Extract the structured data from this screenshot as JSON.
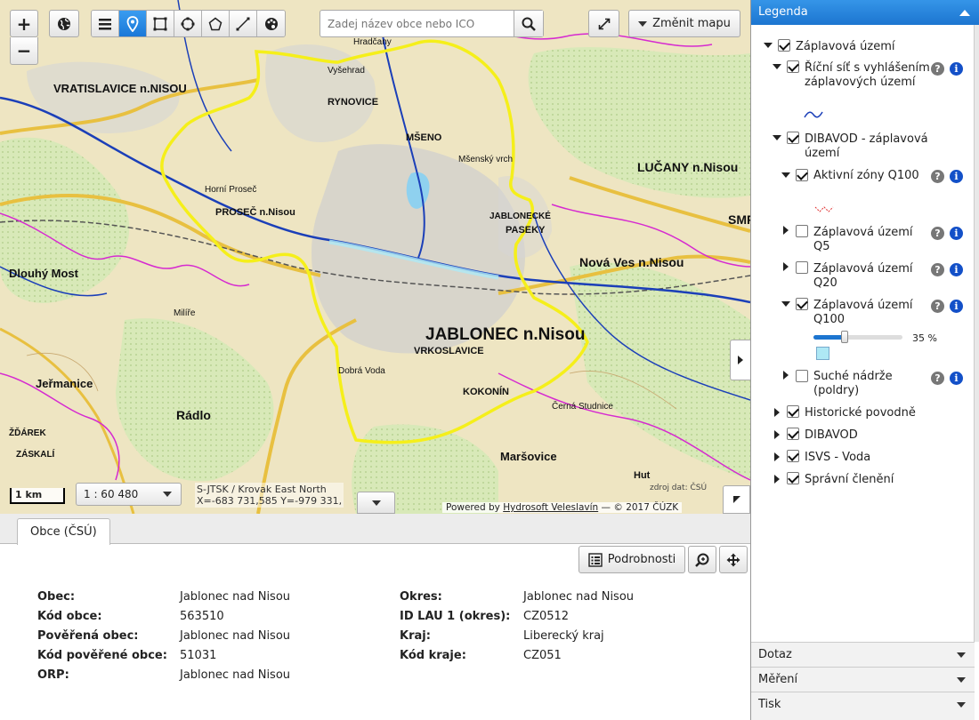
{
  "toolbar": {
    "zoom_in": "+",
    "zoom_out": "−",
    "icons": [
      "globe-icon",
      "layers-list-icon",
      "pin-icon",
      "rectangle-icon",
      "circle-icon",
      "polygon-icon",
      "line-icon",
      "palette-icon",
      "search-icon",
      "fullscreen-icon"
    ],
    "active_tool": "pin",
    "search_placeholder": "Zadej název obce nebo ICO",
    "change_map_label": "Změnit mapu"
  },
  "map": {
    "labels": [
      "VRATISLAVICE n.NISOU",
      "RYNOVICE",
      "MŠENO",
      "JABLONEC n.Nisou",
      "VRKOSLAVICE",
      "PASEKY",
      "JABLONECKÉ",
      "Nová Ves n.Nisou",
      "LUČANY n.Nisou",
      "PROSEČ n.Nisou",
      "Dlouhý Most",
      "Jeřmanice",
      "Rádlo",
      "Maršovice",
      "KOKONÍN",
      "Horní Proseč",
      "Mšenský vrch",
      "Hradčany",
      "Vyšehrad",
      "Milíře",
      "Dobrá Voda",
      "ŽĎÁREK",
      "ZÁSKALÍ",
      "Hut",
      "Černá Studnice",
      "SMR"
    ],
    "scale_bar": "1 km",
    "scale": "1 : 60 480",
    "crs": "S-JTSK / Krovak East North",
    "coords": "X=-683 731,585 Y=-979 331,",
    "powered_prefix": "Powered by",
    "powered_link": "Hydrosoft Veleslavín",
    "copyright": "— © 2017 ČÚZK",
    "source": "zdroj dat: ČSÚ"
  },
  "bottom": {
    "tab": "Obce (ČSÚ)",
    "details_button": "Podrobnosti",
    "left_fields": [
      {
        "key": "Obec:",
        "value": "Jablonec nad Nisou"
      },
      {
        "key": "Kód obce:",
        "value": "563510"
      },
      {
        "key": "Pověřená obec:",
        "value": "Jablonec nad Nisou"
      },
      {
        "key": "Kód pověřené obce:",
        "value": "51031"
      },
      {
        "key": "ORP:",
        "value": "Jablonec nad Nisou"
      }
    ],
    "right_fields": [
      {
        "key": "Okres:",
        "value": "Jablonec nad Nisou"
      },
      {
        "key": "ID LAU 1 (okres):",
        "value": "CZ0512"
      },
      {
        "key": "Kraj:",
        "value": "Liberecký kraj"
      },
      {
        "key": "Kód kraje:",
        "value": "CZ051"
      }
    ]
  },
  "legend": {
    "title": "Legenda",
    "items": [
      {
        "label": "Záplavová území",
        "checked": true,
        "expanded": true
      },
      {
        "label": "Říční síť s vyhlášením záplavových území",
        "checked": true,
        "expanded": true
      },
      {
        "label": "DIBAVOD - záplavová území",
        "checked": true,
        "expanded": true
      },
      {
        "label": "Aktivní zóny Q100",
        "checked": true,
        "expanded": true
      },
      {
        "label": "Záplavová území Q5",
        "checked": false,
        "expanded": false
      },
      {
        "label": "Záplavová území Q20",
        "checked": false,
        "expanded": false
      },
      {
        "label": "Záplavová území Q100",
        "checked": true,
        "expanded": true
      },
      {
        "label": "Suché nádrže (poldry)",
        "checked": false,
        "expanded": false
      },
      {
        "label": "Historické povodně",
        "checked": true,
        "expanded": false
      },
      {
        "label": "DIBAVOD",
        "checked": true,
        "expanded": false
      },
      {
        "label": "ISVS - Voda",
        "checked": true,
        "expanded": false
      },
      {
        "label": "Správní členění",
        "checked": true,
        "expanded": false
      }
    ],
    "opacity_label": "35 %",
    "opacity_value": 0.35,
    "help_glyph": "?",
    "info_glyph": "i"
  },
  "panels": {
    "query": "Dotaz",
    "measure": "Měření",
    "print": "Tisk"
  },
  "colors": {
    "accent": "#1c75d0",
    "boundary": "#f5ef1a",
    "river": "#1b3fb8",
    "admin_line": "#d62ad0",
    "q100_fill": "#aee8f5"
  }
}
